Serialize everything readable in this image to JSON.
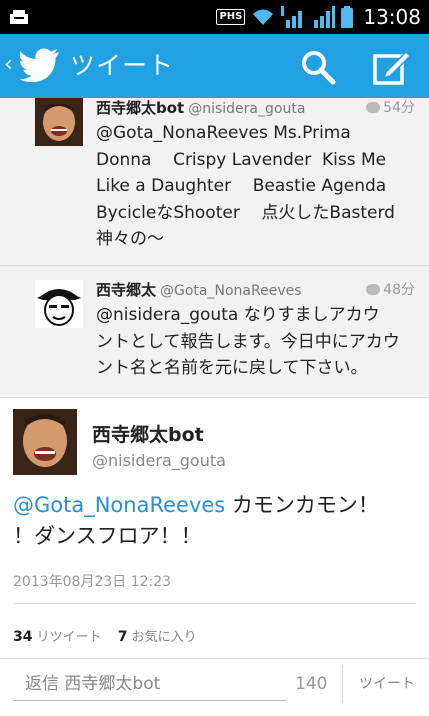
{
  "status_bar": {
    "carrier_badge": "PHS",
    "time": "13:08"
  },
  "app_bar": {
    "title": "ツイート",
    "back_glyph": "‹"
  },
  "timeline": [
    {
      "name": "西寺郷太bot",
      "handle": "@nisidera_gouta",
      "time": "54分",
      "lines": [
        "@Gota_NonaReeves Ms.Prima",
        "Donna    Crispy Lavender  Kiss Me",
        "Like a Daughter    Beastie Agenda",
        "BycicleなShooter    点火したBasterd",
        "神々の〜"
      ]
    },
    {
      "name": "西寺郷太",
      "handle": "@Gota_NonaReeves",
      "time": "48分",
      "lines": [
        "@nisidera_gouta なりすましアカウ",
        "ントとして報告します。今日中にアカウ",
        "ント名と名前を元に戻して下さい。"
      ]
    }
  ],
  "detail": {
    "name": "西寺郷太bot",
    "handle": "@nisidera_gouta",
    "mention": "@Gota_NonaReeves",
    "text_line1_rest": " カモンカモン！",
    "text_line2": "！ダンスフロア！！",
    "date": "2013年08月23日 12:23",
    "retweet_count": "34",
    "retweet_label": "リツイート",
    "favorite_count": "7",
    "favorite_label": "お気に入り"
  },
  "reply": {
    "placeholder": "返信 西寺郷太bot",
    "char_count": "140",
    "send_label": "ツイート"
  },
  "colors": {
    "accent": "#21a1e1",
    "link": "#2b8fd6"
  },
  "icons": [
    "twitter-bird-icon",
    "search-icon",
    "compose-icon",
    "wifi-icon",
    "signal-icon",
    "battery-icon",
    "notification-icon",
    "reply-bubble-icon"
  ]
}
